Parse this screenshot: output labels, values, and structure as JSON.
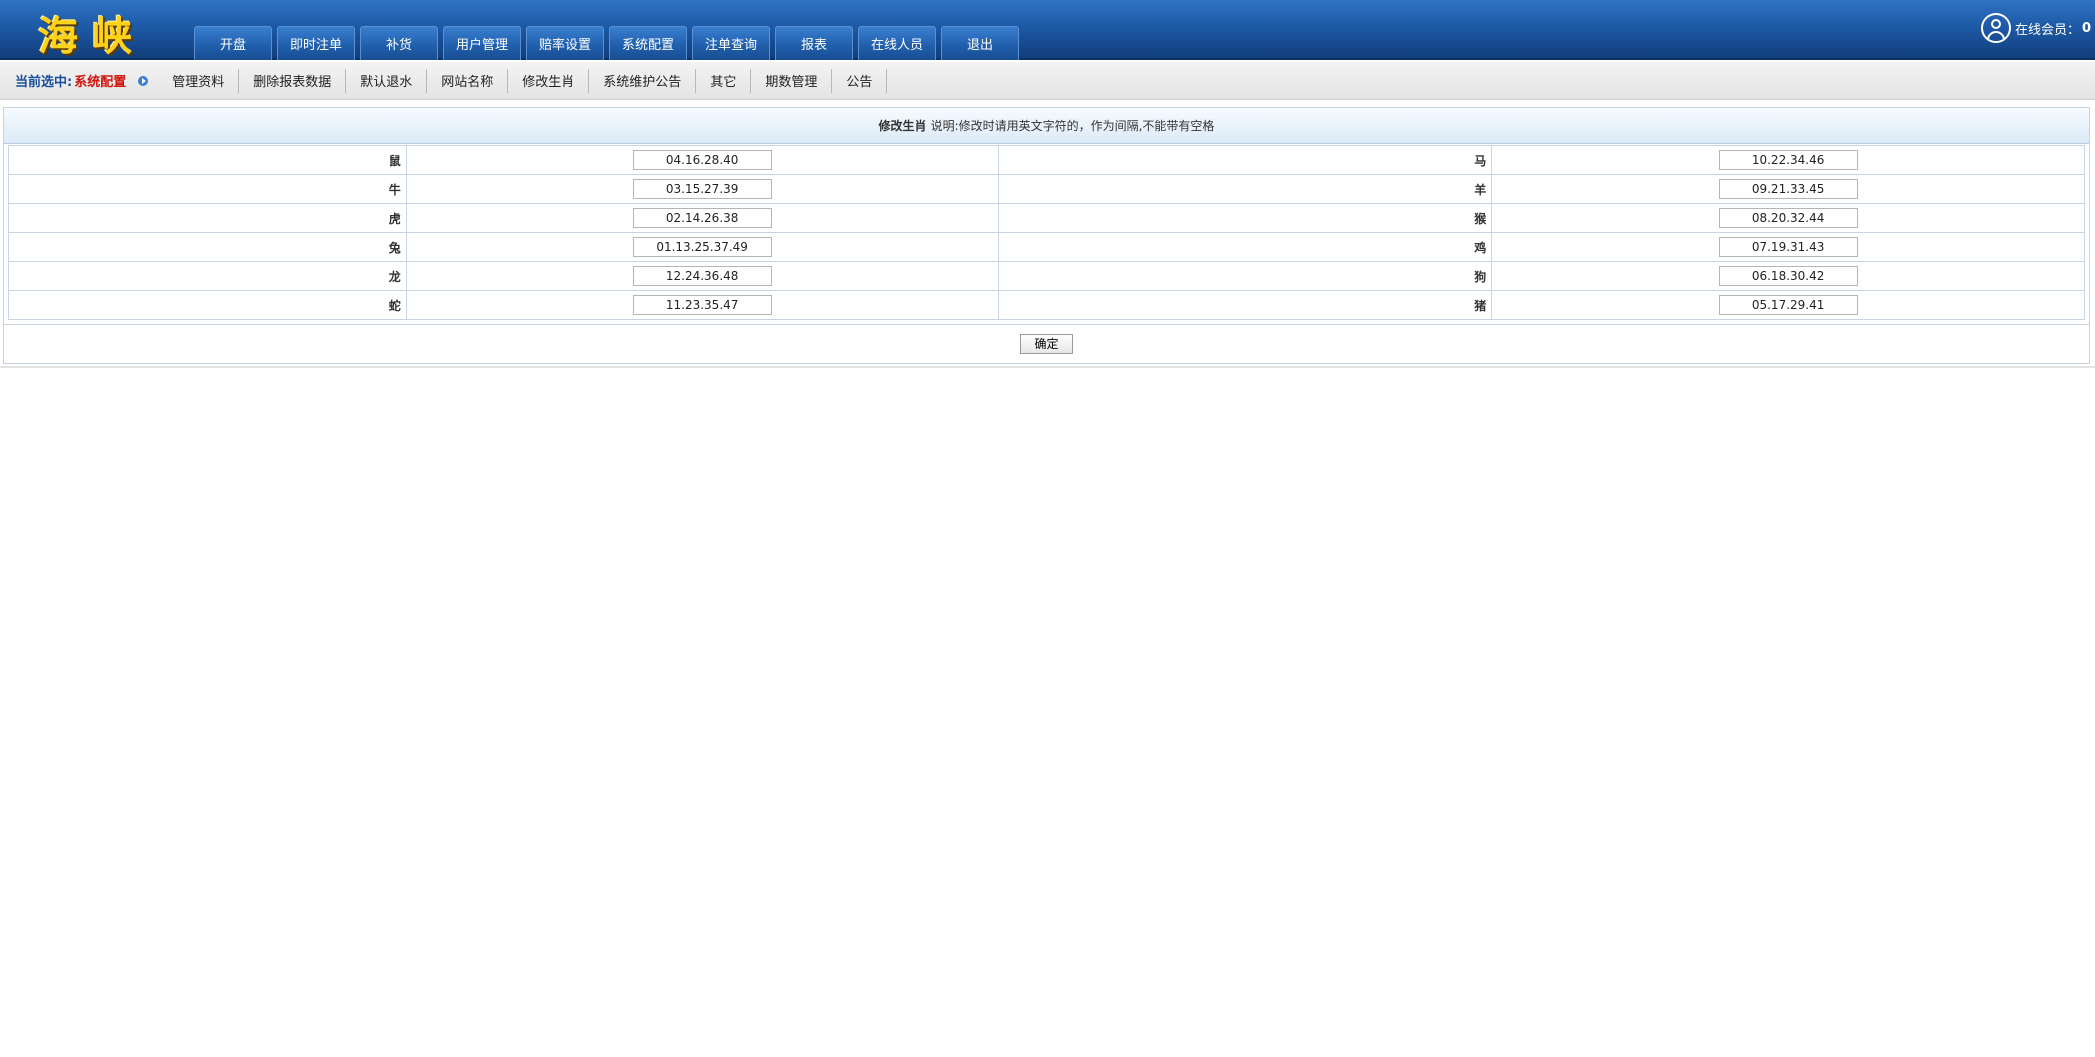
{
  "header": {
    "logo": "海峡",
    "nav": [
      "开盘",
      "即时注单",
      "补货",
      "用户管理",
      "赔率设置",
      "系统配置",
      "注单查询",
      "报表",
      "在线人员",
      "退出"
    ],
    "online_label": "在线会员：",
    "online_count": "0"
  },
  "subbar": {
    "current_label": "当前选中:",
    "current_value": "系统配置",
    "items": [
      "管理资料",
      "删除报表数据",
      "默认退水",
      "网站名称",
      "修改生肖",
      "系统维护公告",
      "其它",
      "期数管理",
      "公告"
    ]
  },
  "panel": {
    "title": "修改生肖",
    "note": "说明:修改时请用英文字符的，作为间隔,不能带有空格",
    "rows": [
      {
        "left_label": "鼠",
        "left_value": "04.16.28.40",
        "right_label": "马",
        "right_value": "10.22.34.46"
      },
      {
        "left_label": "牛",
        "left_value": "03.15.27.39",
        "right_label": "羊",
        "right_value": "09.21.33.45"
      },
      {
        "left_label": "虎",
        "left_value": "02.14.26.38",
        "right_label": "猴",
        "right_value": "08.20.32.44"
      },
      {
        "left_label": "兔",
        "left_value": "01.13.25.37.49",
        "right_label": "鸡",
        "right_value": "07.19.31.43"
      },
      {
        "left_label": "龙",
        "left_value": "12.24.36.48",
        "right_label": "狗",
        "right_value": "06.18.30.42"
      },
      {
        "left_label": "蛇",
        "left_value": "11.23.35.47",
        "right_label": "猪",
        "right_value": "05.17.29.41"
      }
    ],
    "submit_label": "确定"
  }
}
